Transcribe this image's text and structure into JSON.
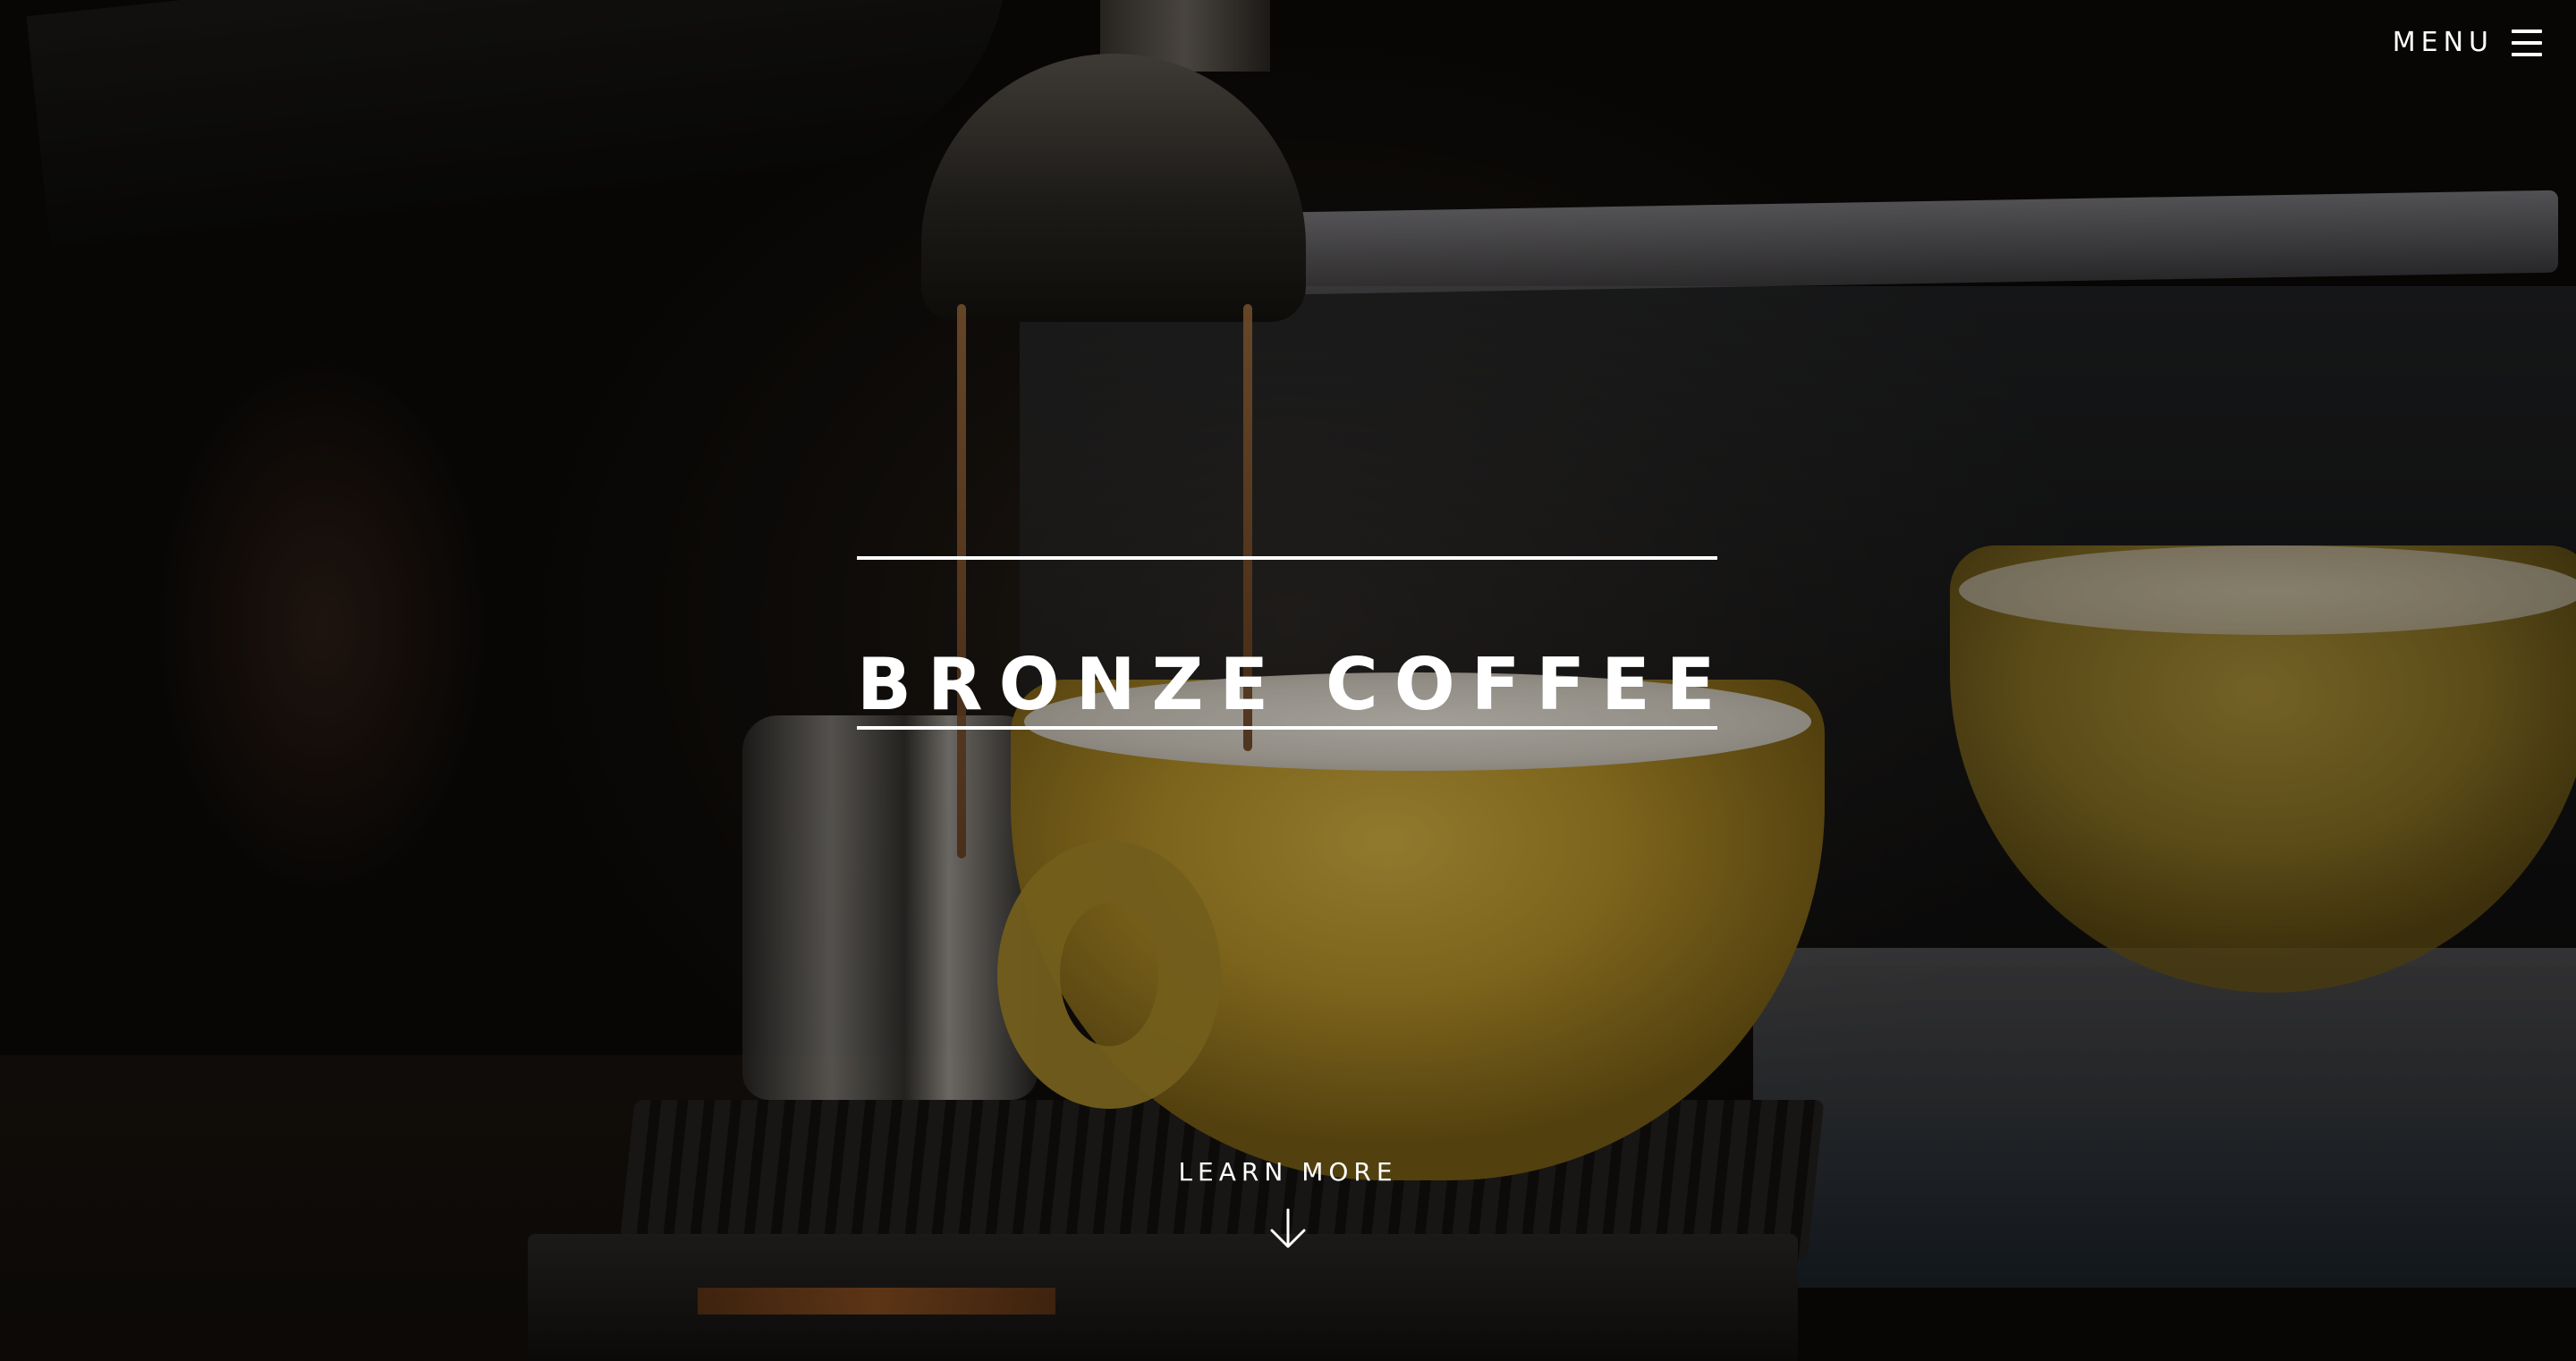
{
  "header": {
    "menu_label": "MENU",
    "menu_icon": "hamburger-icon"
  },
  "hero": {
    "title": "BRONZE COFFEE",
    "cta_label": "LEARN MORE",
    "cta_icon": "arrow-down-icon",
    "background_image": "espresso machine pouring coffee into yellow cup"
  },
  "colors": {
    "text": "#ffffff",
    "overlay": "#000000",
    "cup_yellow": "#c9a535"
  }
}
